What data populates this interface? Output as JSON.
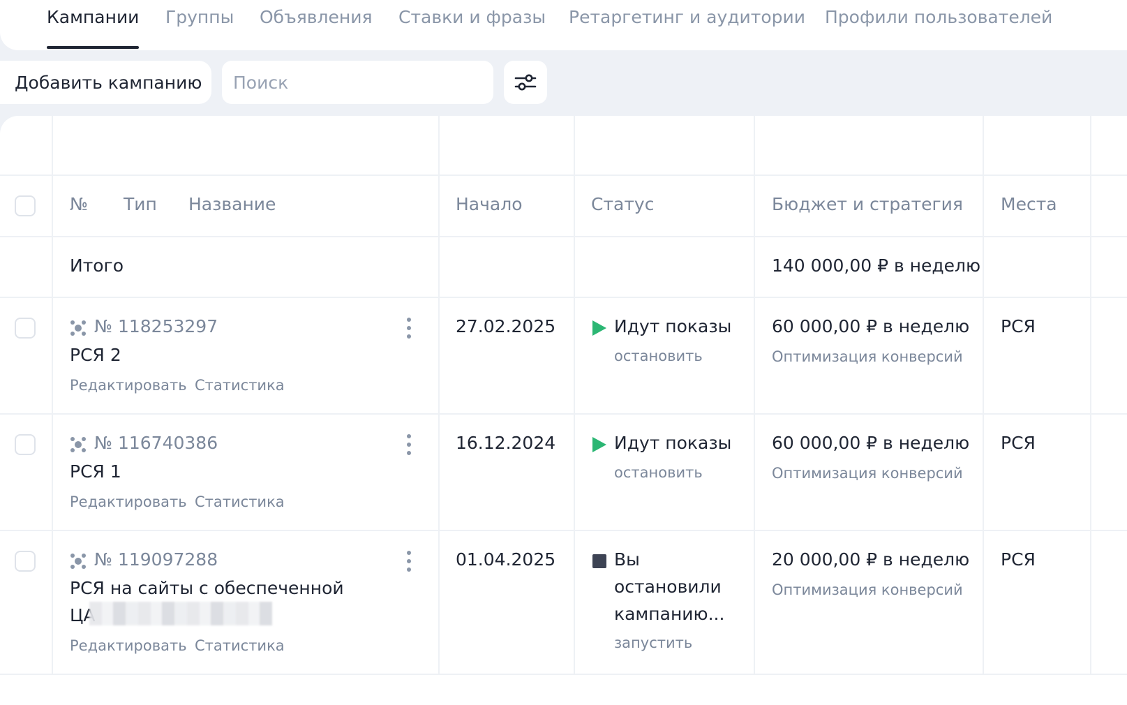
{
  "tabs": [
    {
      "label": "Кампании",
      "active": true
    },
    {
      "label": "Группы",
      "active": false
    },
    {
      "label": "Объявления",
      "active": false
    },
    {
      "label": "Ставки и фразы",
      "active": false
    },
    {
      "label": "Ретаргетинг и аудитории",
      "active": false
    },
    {
      "label": "Профили пользователей",
      "active": false
    }
  ],
  "toolbar": {
    "add_label": "Добавить кампанию",
    "search_placeholder": "Поиск",
    "filter_icon": "sliders-icon"
  },
  "table": {
    "headers": {
      "number": "№",
      "type": "Тип",
      "name": "Название",
      "start": "Начало",
      "status": "Статус",
      "budget": "Бюджет и стратегия",
      "places": "Места"
    },
    "total": {
      "label": "Итого",
      "budget": "140 000,00 ₽ в неделю"
    },
    "rows": [
      {
        "number": "№ 118253297",
        "name": "РСЯ 2",
        "edit": "Редактировать",
        "stats": "Статистика",
        "start": "27.02.2025",
        "status": "Идут показы",
        "status_action": "остановить",
        "budget": "60 000,00 ₽ в неделю",
        "strategy": "Оптимизация конверсий",
        "places": "РСЯ"
      },
      {
        "number": "№ 116740386",
        "name": "РСЯ 1",
        "edit": "Редактировать",
        "stats": "Статистика",
        "start": "16.12.2024",
        "status": "Идут показы",
        "status_action": "остановить",
        "budget": "60 000,00 ₽ в неделю",
        "strategy": "Оптимизация конверсий",
        "places": "РСЯ"
      },
      {
        "number": "№ 119097288",
        "name_line1": "РСЯ на сайты с обеспеченной",
        "name_line2": "ЦА",
        "edit": "Редактировать",
        "stats": "Статистика",
        "start": "01.04.2025",
        "status_line1": "Вы",
        "status_line2": "остановили",
        "status_line3": "кампанию...",
        "status_action": "запустить",
        "budget": "20 000,00 ₽ в неделю",
        "strategy": "Оптимизация конверсий",
        "places": "РСЯ"
      }
    ]
  },
  "colors": {
    "accent_green": "#2bb673",
    "stopped": "#3d4354",
    "muted_text": "#7b879a",
    "background": "#eef1f6"
  }
}
